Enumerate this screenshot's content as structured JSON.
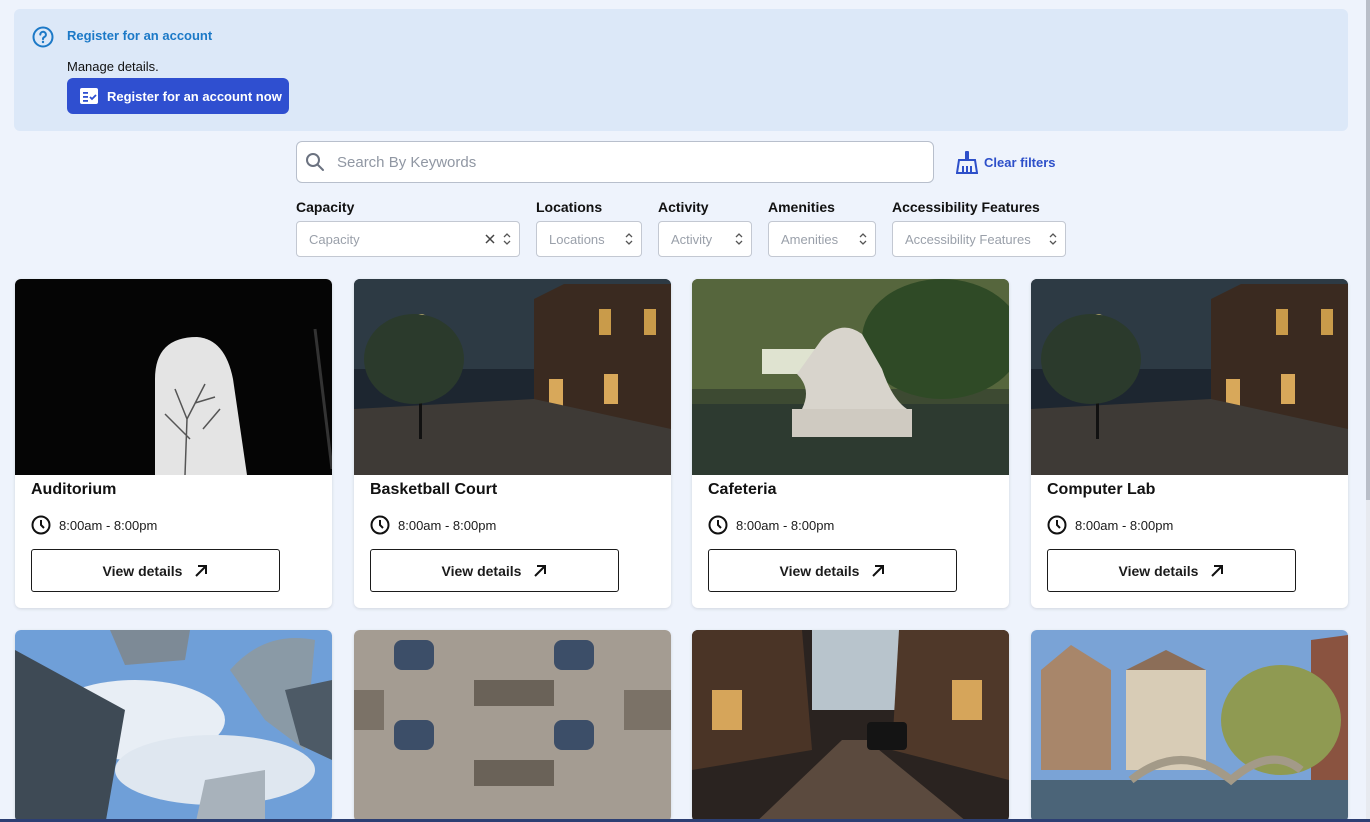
{
  "banner": {
    "title": "Register for an account",
    "subtitle": "Manage details.",
    "button_label": "Register for an account now"
  },
  "search": {
    "placeholder": "Search By Keywords",
    "value": ""
  },
  "clear_filters_label": "Clear filters",
  "filters": [
    {
      "label": "Capacity",
      "placeholder": "Capacity"
    },
    {
      "label": "Locations",
      "placeholder": "Locations"
    },
    {
      "label": "Activity",
      "placeholder": "Activity"
    },
    {
      "label": "Amenities",
      "placeholder": "Amenities"
    },
    {
      "label": "Accessibility Features",
      "placeholder": "Accessibility Features"
    }
  ],
  "cards": [
    {
      "name": "Auditorium",
      "hours": "8:00am - 8:00pm",
      "button": "View details",
      "image": "dark-archway-tree"
    },
    {
      "name": "Basketball Court",
      "hours": "8:00am - 8:00pm",
      "button": "View details",
      "image": "night-street-lamp"
    },
    {
      "name": "Cafeteria",
      "hours": "8:00am - 8:00pm",
      "button": "View details",
      "image": "garden-statue-fountain"
    },
    {
      "name": "Computer Lab",
      "hours": "8:00am - 8:00pm",
      "button": "View details",
      "image": "night-street-lamp"
    },
    {
      "image": "skyscrapers-sky"
    },
    {
      "image": "apartment-balconies"
    },
    {
      "image": "wet-street-vintage-car"
    },
    {
      "image": "canal-bridge-town"
    }
  ],
  "colors": {
    "page_bg": "#eef3fc",
    "banner_bg": "#dce8f8",
    "primary": "#2f4fd0",
    "link": "#1c79c7"
  }
}
